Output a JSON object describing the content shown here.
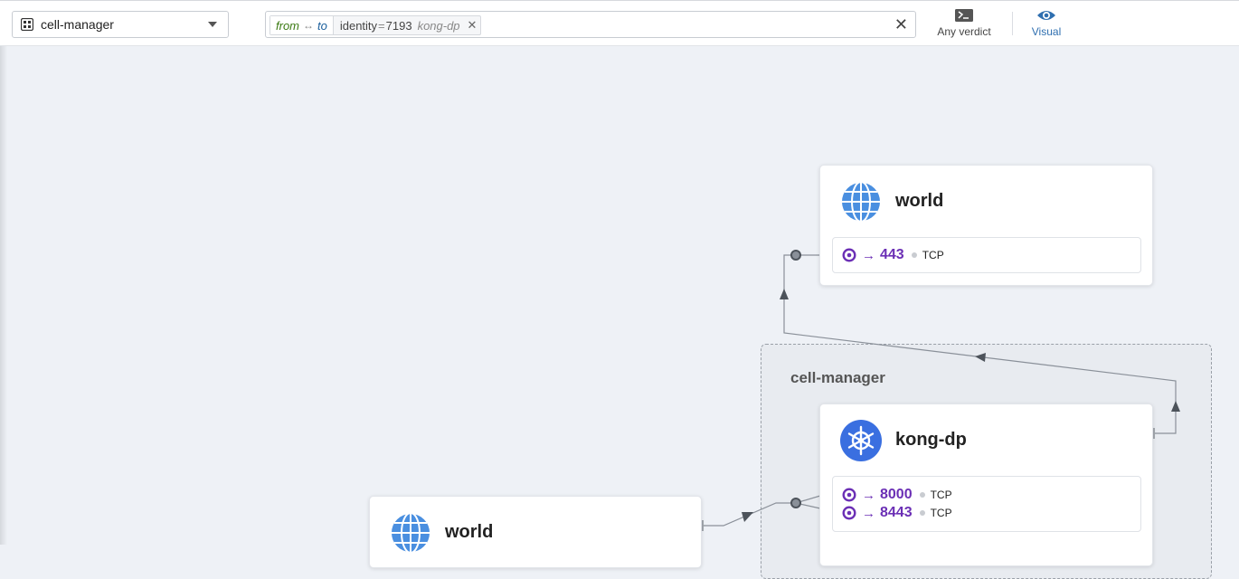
{
  "toolbar": {
    "namespace": "cell-manager",
    "filter": {
      "from": "from",
      "arrow": "↔",
      "to": "to",
      "kind": "identity",
      "eq": "=",
      "value": "7193",
      "name": "kong-dp"
    },
    "verdict_label": "Any verdict",
    "visual_label": "Visual"
  },
  "namespace_group": {
    "label": "cell-manager"
  },
  "nodes": {
    "world_top": {
      "title": "world",
      "ports": [
        {
          "arrow": "→",
          "port": "443",
          "protocol": "TCP"
        }
      ]
    },
    "kong_dp": {
      "title": "kong-dp",
      "ports": [
        {
          "arrow": "→",
          "port": "8000",
          "protocol": "TCP"
        },
        {
          "arrow": "→",
          "port": "8443",
          "protocol": "TCP"
        }
      ]
    },
    "world_bottom": {
      "title": "world"
    }
  },
  "colors": {
    "port_purple": "#6b2fb5",
    "globe_blue": "#4a8fe0",
    "k8s_blue": "#3a6fe0",
    "visual_blue": "#2f6fb0"
  }
}
